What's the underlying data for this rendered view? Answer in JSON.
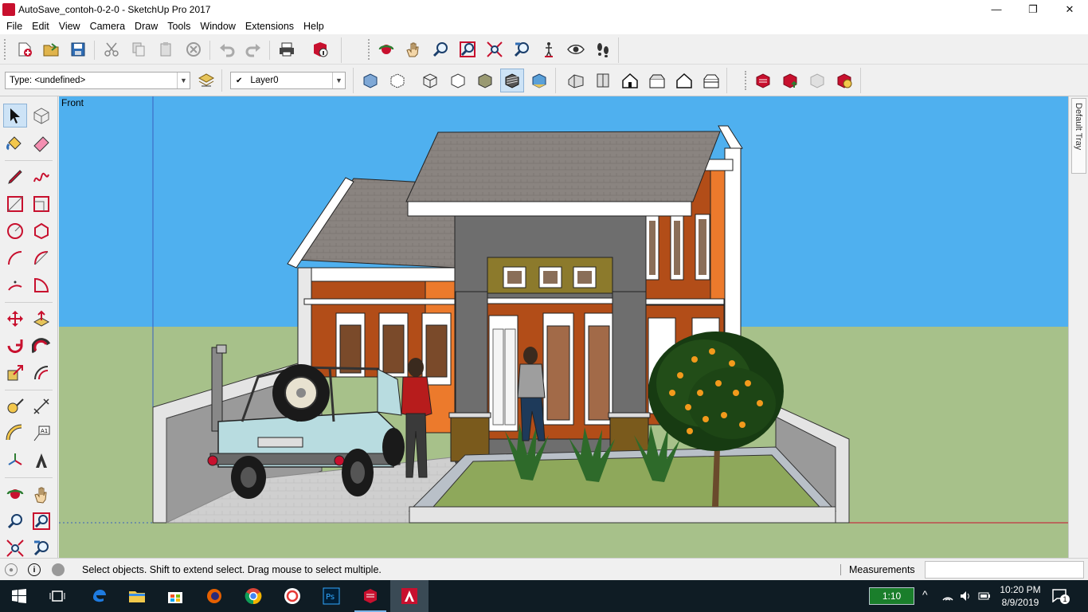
{
  "window": {
    "title": "AutoSave_contoh-0-2-0 - SketchUp Pro 2017",
    "controls": {
      "minimize": "—",
      "maximize": "❐",
      "close": "✕"
    }
  },
  "menu": [
    "File",
    "Edit",
    "View",
    "Camera",
    "Draw",
    "Tools",
    "Window",
    "Extensions",
    "Help"
  ],
  "toolbar": {
    "type_combo": "Type: <undefined>",
    "layer_check": "✔",
    "layer_combo": "Layer0"
  },
  "viewport": {
    "scene_label": "Front",
    "active_tool": "select-tool"
  },
  "tray": {
    "label": "Default Tray"
  },
  "status": {
    "message": "Select objects. Shift to extend select. Drag mouse to select multiple.",
    "measurements_label": "Measurements",
    "measurements_value": ""
  },
  "taskbar": {
    "battery": "1:10",
    "time": "10:20 PM",
    "date": "8/9/2019",
    "notifications": "1",
    "chevron": "^"
  },
  "colors": {
    "sky": "#4fb0ef",
    "ground": "#a7c18a",
    "accent": "#c8102e",
    "taskbar": "#0f1c24"
  }
}
